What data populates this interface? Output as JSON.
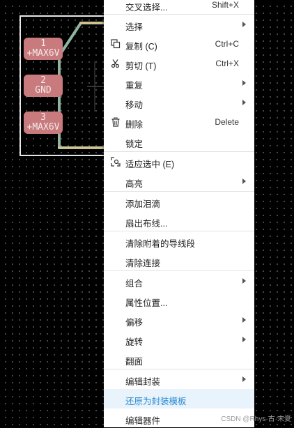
{
  "pads": [
    {
      "number": "1",
      "net": "+MAX6V"
    },
    {
      "number": "2",
      "net": "GND"
    },
    {
      "number": "3",
      "net": "+MAX6V"
    }
  ],
  "menu": {
    "items": [
      {
        "label": "交叉选择...",
        "shortcut": "Shift+X",
        "icon": "",
        "submenu": false
      },
      {
        "label": "选择",
        "shortcut": "",
        "icon": "",
        "submenu": true
      },
      {
        "label": "复制 (C)",
        "shortcut": "Ctrl+C",
        "icon": "copy-icon",
        "submenu": false
      },
      {
        "label": "剪切 (T)",
        "shortcut": "Ctrl+X",
        "icon": "scissors-icon",
        "submenu": false
      },
      {
        "label": "重复",
        "shortcut": "",
        "icon": "",
        "submenu": true
      },
      {
        "label": "移动",
        "shortcut": "",
        "icon": "",
        "submenu": true
      },
      {
        "label": "删除",
        "shortcut": "Delete",
        "icon": "trash-icon",
        "submenu": false
      },
      {
        "label": "锁定",
        "shortcut": "",
        "icon": "",
        "submenu": false
      },
      {
        "label": "适应选中 (E)",
        "shortcut": "",
        "icon": "fit-selection-icon",
        "submenu": false
      },
      {
        "label": "高亮",
        "shortcut": "",
        "icon": "",
        "submenu": true
      },
      {
        "label": "添加泪滴",
        "shortcut": "",
        "icon": "",
        "submenu": false
      },
      {
        "label": "扇出布线...",
        "shortcut": "",
        "icon": "",
        "submenu": false
      },
      {
        "label": "清除附着的导线段",
        "shortcut": "",
        "icon": "",
        "submenu": false
      },
      {
        "label": "清除连接",
        "shortcut": "",
        "icon": "",
        "submenu": false
      },
      {
        "label": "组合",
        "shortcut": "",
        "icon": "",
        "submenu": true
      },
      {
        "label": "属性位置...",
        "shortcut": "",
        "icon": "",
        "submenu": false
      },
      {
        "label": "偏移",
        "shortcut": "",
        "icon": "",
        "submenu": true
      },
      {
        "label": "旋转",
        "shortcut": "",
        "icon": "",
        "submenu": true
      },
      {
        "label": "翻面",
        "shortcut": "",
        "icon": "",
        "submenu": false
      },
      {
        "label": "编辑封装",
        "shortcut": "",
        "icon": "",
        "submenu": true
      },
      {
        "label": "还原为封装模板",
        "shortcut": "",
        "icon": "",
        "submenu": false,
        "highlighted": true
      },
      {
        "label": "编辑器件",
        "shortcut": "",
        "icon": "",
        "submenu": false
      }
    ]
  },
  "watermark": "CSDN @Rhys·古·末夏",
  "colors": {
    "pad": "#c87a7d",
    "silkscreen_outline": "#8fb5a0",
    "selection_box": "#e6e6e6",
    "highlight_text": "#2d8cd2",
    "highlight_bg": "#e8f3fb"
  }
}
